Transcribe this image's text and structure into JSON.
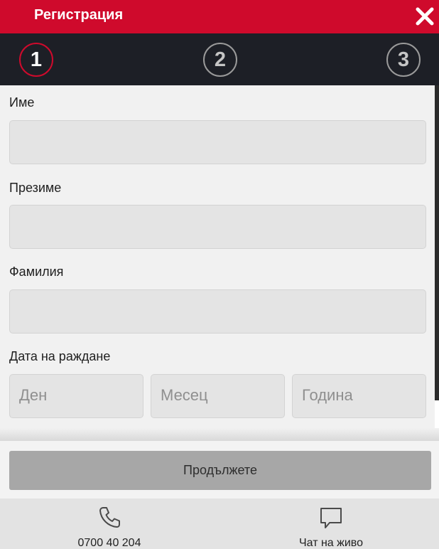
{
  "header": {
    "title": "Регистрация"
  },
  "steps": [
    "1",
    "2",
    "3"
  ],
  "form": {
    "first_name_label": "Име",
    "middle_name_label": "Презиме",
    "last_name_label": "Фамилия",
    "birthdate_label": "Дата на раждане",
    "day_placeholder": "Ден",
    "month_placeholder": "Месец",
    "year_placeholder": "Година"
  },
  "actions": {
    "continue_label": "Продължете"
  },
  "footer": {
    "phone": "0700 40 204",
    "chat": "Чат на живо"
  },
  "colors": {
    "accent": "#cf0a2c",
    "steps_bg": "#1d1f26",
    "button": "#a7a7a7"
  }
}
